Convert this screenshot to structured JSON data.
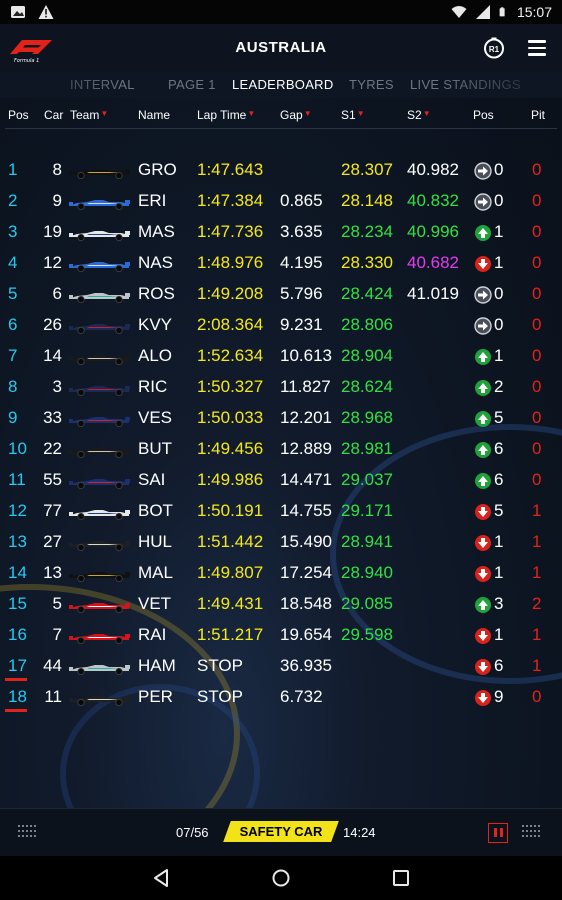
{
  "status_bar": {
    "time": "15:07"
  },
  "header": {
    "title": "AUSTRALIA",
    "round_badge": "R1"
  },
  "tabs": [
    {
      "label": "INTERVAL",
      "active": false
    },
    {
      "label": "PAGE 1",
      "active": false
    },
    {
      "label": "LEADERBOARD",
      "active": true
    },
    {
      "label": "TYRES",
      "active": false
    },
    {
      "label": "LIVE STANDINGS",
      "active": false
    }
  ],
  "columns": {
    "pos": "Pos",
    "car": "Car",
    "team": "Team",
    "name": "Name",
    "lap_time": "Lap Time",
    "gap": "Gap",
    "s1": "S1",
    "s2": "S2",
    "pos_change": "Pos",
    "pit": "Pit"
  },
  "colors": {
    "position": "#28c8f0",
    "lap_time": "#f5e81a",
    "sector_yellow": "#f5e81a",
    "sector_green": "#33e043",
    "sector_purple": "#e23cf0",
    "accent_red": "#e2231a",
    "gained": "#1fa23a",
    "lost": "#d8221c",
    "same": "#4a4f57"
  },
  "rows": [
    {
      "pos": "1",
      "car": "8",
      "team": "lotus",
      "name": "GRO",
      "lap": "1:47.643",
      "gap": "",
      "s1": "28.307",
      "s1c": "yellow",
      "s2": "40.982",
      "s2c": "white",
      "dir": "same",
      "change": "0",
      "pit": "0"
    },
    {
      "pos": "2",
      "car": "9",
      "team": "sauber",
      "name": "ERI",
      "lap": "1:47.384",
      "gap": "0.865",
      "s1": "28.148",
      "s1c": "yellow",
      "s2": "40.832",
      "s2c": "green",
      "dir": "same",
      "change": "0",
      "pit": "0"
    },
    {
      "pos": "3",
      "car": "19",
      "team": "williams",
      "name": "MAS",
      "lap": "1:47.736",
      "gap": "3.635",
      "s1": "28.234",
      "s1c": "green",
      "s2": "40.996",
      "s2c": "green",
      "dir": "up",
      "change": "1",
      "pit": "0"
    },
    {
      "pos": "4",
      "car": "12",
      "team": "sauber",
      "name": "NAS",
      "lap": "1:48.976",
      "gap": "4.195",
      "s1": "28.330",
      "s1c": "yellow",
      "s2": "40.682",
      "s2c": "purple",
      "dir": "down",
      "change": "1",
      "pit": "0"
    },
    {
      "pos": "5",
      "car": "6",
      "team": "mercedes",
      "name": "ROS",
      "lap": "1:49.208",
      "gap": "5.796",
      "s1": "28.424",
      "s1c": "green",
      "s2": "41.019",
      "s2c": "white",
      "dir": "same",
      "change": "0",
      "pit": "0"
    },
    {
      "pos": "6",
      "car": "26",
      "team": "redbull",
      "name": "KVY",
      "lap": "2:08.364",
      "gap": "9.231",
      "s1": "28.806",
      "s1c": "green",
      "s2": "",
      "s2c": "white",
      "dir": "same",
      "change": "0",
      "pit": "0"
    },
    {
      "pos": "7",
      "car": "14",
      "team": "mclaren",
      "name": "ALO",
      "lap": "1:52.634",
      "gap": "10.613",
      "s1": "28.904",
      "s1c": "green",
      "s2": "",
      "s2c": "white",
      "dir": "up",
      "change": "1",
      "pit": "0"
    },
    {
      "pos": "8",
      "car": "3",
      "team": "redbull",
      "name": "RIC",
      "lap": "1:50.327",
      "gap": "11.827",
      "s1": "28.624",
      "s1c": "green",
      "s2": "",
      "s2c": "white",
      "dir": "up",
      "change": "2",
      "pit": "0"
    },
    {
      "pos": "9",
      "car": "33",
      "team": "tororosso",
      "name": "VES",
      "lap": "1:50.033",
      "gap": "12.201",
      "s1": "28.968",
      "s1c": "green",
      "s2": "",
      "s2c": "white",
      "dir": "up",
      "change": "5",
      "pit": "0"
    },
    {
      "pos": "10",
      "car": "22",
      "team": "mclaren",
      "name": "BUT",
      "lap": "1:49.456",
      "gap": "12.889",
      "s1": "28.981",
      "s1c": "green",
      "s2": "",
      "s2c": "white",
      "dir": "up",
      "change": "6",
      "pit": "0"
    },
    {
      "pos": "11",
      "car": "55",
      "team": "tororosso",
      "name": "SAI",
      "lap": "1:49.986",
      "gap": "14.471",
      "s1": "29.037",
      "s1c": "green",
      "s2": "",
      "s2c": "white",
      "dir": "up",
      "change": "6",
      "pit": "0"
    },
    {
      "pos": "12",
      "car": "77",
      "team": "williams",
      "name": "BOT",
      "lap": "1:50.191",
      "gap": "14.755",
      "s1": "29.171",
      "s1c": "green",
      "s2": "",
      "s2c": "white",
      "dir": "down",
      "change": "5",
      "pit": "1"
    },
    {
      "pos": "13",
      "car": "27",
      "team": "forceindia",
      "name": "HUL",
      "lap": "1:51.442",
      "gap": "15.490",
      "s1": "28.941",
      "s1c": "green",
      "s2": "",
      "s2c": "white",
      "dir": "down",
      "change": "1",
      "pit": "1"
    },
    {
      "pos": "14",
      "car": "13",
      "team": "lotus",
      "name": "MAL",
      "lap": "1:49.807",
      "gap": "17.254",
      "s1": "28.940",
      "s1c": "green",
      "s2": "",
      "s2c": "white",
      "dir": "down",
      "change": "1",
      "pit": "1"
    },
    {
      "pos": "15",
      "car": "5",
      "team": "ferrari",
      "name": "VET",
      "lap": "1:49.431",
      "gap": "18.548",
      "s1": "29.085",
      "s1c": "green",
      "s2": "",
      "s2c": "white",
      "dir": "up",
      "change": "3",
      "pit": "2"
    },
    {
      "pos": "16",
      "car": "7",
      "team": "ferrari",
      "name": "RAI",
      "lap": "1:51.217",
      "gap": "19.654",
      "s1": "29.598",
      "s1c": "green",
      "s2": "",
      "s2c": "white",
      "dir": "down",
      "change": "1",
      "pit": "1"
    },
    {
      "pos": "17",
      "car": "44",
      "team": "mercedes",
      "name": "HAM",
      "lap": "STOP",
      "gap": "36.935",
      "s1": "",
      "s1c": "white",
      "s2": "",
      "s2c": "white",
      "dir": "down",
      "change": "6",
      "pit": "1",
      "retired": true
    },
    {
      "pos": "18",
      "car": "11",
      "team": "forceindia",
      "name": "PER",
      "lap": "STOP",
      "gap": "6.732",
      "s1": "",
      "s1c": "white",
      "s2": "",
      "s2c": "white",
      "dir": "down",
      "change": "9",
      "pit": "0",
      "retired": true
    }
  ],
  "footer": {
    "lap_count": "07/56",
    "status": "SAFETY CAR",
    "clock": "14:24"
  }
}
